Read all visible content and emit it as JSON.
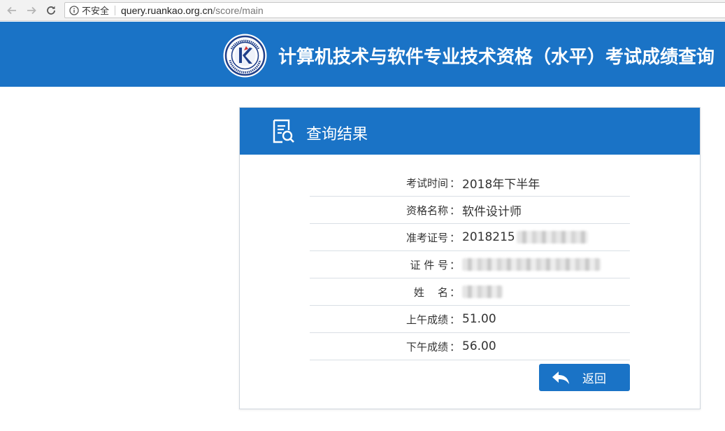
{
  "browser": {
    "security_label": "不安全",
    "url_host": "query.ruankao.org.cn",
    "url_path": "/score/main"
  },
  "header": {
    "title": "计算机技术与软件专业技术资格（水平）考试成绩查询",
    "brand_color": "#1a73c6"
  },
  "panel": {
    "title": "查询结果",
    "rows": [
      {
        "label": "考试时间",
        "value": "2018年下半年"
      },
      {
        "label": "资格名称",
        "value": "软件设计师"
      },
      {
        "label": "准考证号",
        "value": "2018215"
      },
      {
        "label": "证 件 号",
        "value": ""
      },
      {
        "label": "姓    名",
        "value": ""
      },
      {
        "label": "上午成绩",
        "value": "51.00"
      },
      {
        "label": "下午成绩",
        "value": "56.00"
      }
    ],
    "back_label": "返回"
  }
}
